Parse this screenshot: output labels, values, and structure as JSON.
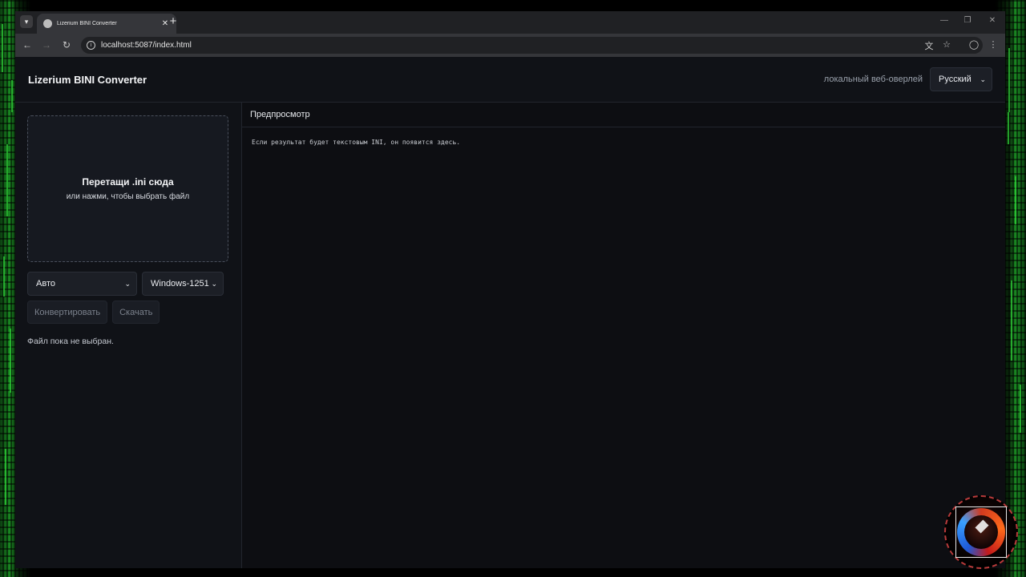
{
  "browser": {
    "tab_title": "Lizerium BINI Converter",
    "url": "localhost:5087/index.html"
  },
  "app": {
    "title": "Lizerium BINI Converter",
    "overlay_label": "локальный веб-оверлей",
    "language_select": "Русский"
  },
  "dropzone": {
    "title": "Перетащи .ini сюда",
    "subtitle": "или нажми, чтобы выбрать файл"
  },
  "controls": {
    "mode_select": "Авто",
    "encoding_select": "Windows-1251",
    "convert_label": "Конвертировать",
    "download_label": "Скачать"
  },
  "status": "Файл пока не выбран.",
  "preview": {
    "heading": "Предпросмотр",
    "placeholder": "Если результат будет текстовым INI, он появится здесь."
  }
}
